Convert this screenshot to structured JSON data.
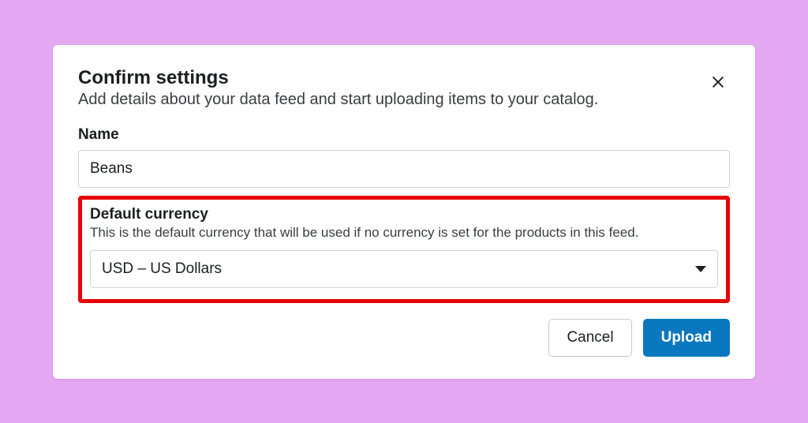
{
  "dialog": {
    "title": "Confirm settings",
    "subtitle": "Add details about your data feed and start uploading items to your catalog."
  },
  "form": {
    "name": {
      "label": "Name",
      "value": "Beans"
    },
    "currency": {
      "label": "Default currency",
      "help": "This is the default currency that will be used if no currency is set for the products in this feed.",
      "selected": "USD – US Dollars"
    }
  },
  "buttons": {
    "cancel": "Cancel",
    "upload": "Upload"
  }
}
